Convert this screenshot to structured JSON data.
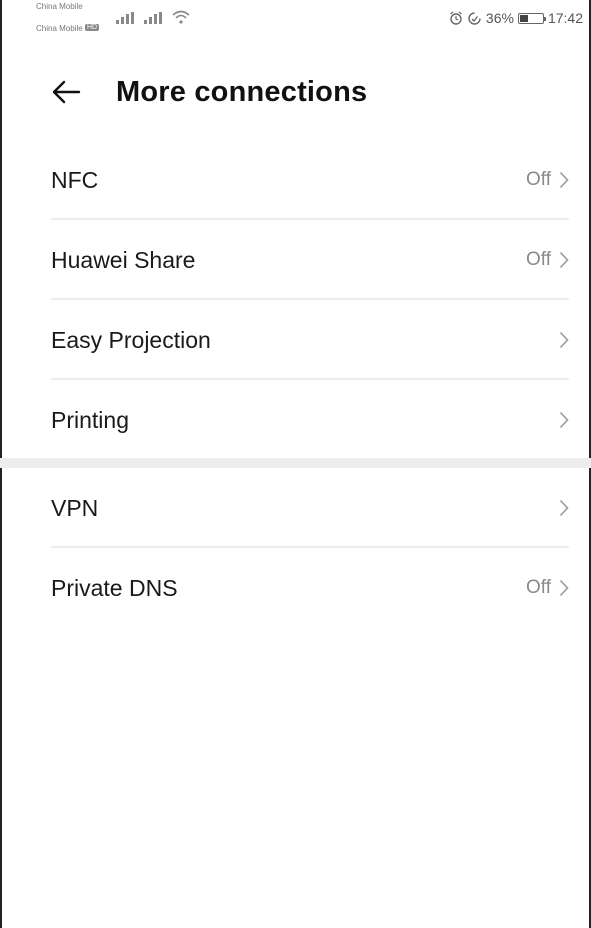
{
  "status_bar": {
    "carrier_1": "China Mobile",
    "carrier_2": "China Mobile",
    "sim_badge": "HD",
    "battery_percent": "36%",
    "battery_level": 0.36,
    "time": "17:42",
    "icons": [
      "signal-icon",
      "signal-icon",
      "wifi-icon",
      "alarm-icon",
      "data-saver-icon",
      "battery-icon"
    ]
  },
  "header": {
    "back_icon": "arrow-left-icon",
    "title": "More connections"
  },
  "groups": [
    {
      "items": [
        {
          "label": "NFC",
          "value": "Off"
        },
        {
          "label": "Huawei Share",
          "value": "Off"
        },
        {
          "label": "Easy Projection",
          "value": ""
        },
        {
          "label": "Printing",
          "value": ""
        }
      ]
    },
    {
      "items": [
        {
          "label": "VPN",
          "value": ""
        },
        {
          "label": "Private DNS",
          "value": "Off"
        }
      ]
    }
  ],
  "colors": {
    "text": "#1a1a1a",
    "secondary": "#8a8a8a",
    "divider": "#ececec",
    "section_gap": "#ededed"
  }
}
